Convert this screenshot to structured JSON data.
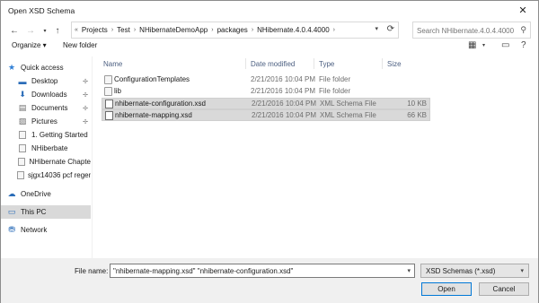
{
  "window": {
    "title": "Open XSD Schema",
    "close_glyph": "✕"
  },
  "nav": {
    "back_icon": "back-arrow-icon",
    "forward_icon": "forward-arrow-icon",
    "recent_icon": "chevron-down-icon",
    "up_icon": "up-arrow-icon",
    "prefix": "«",
    "breadcrumbs": [
      "Projects",
      "Test",
      "NHibernateDemoApp",
      "packages",
      "NHibernate.4.0.4.4000"
    ],
    "search_placeholder": "Search NHibernate.4.0.4.4000"
  },
  "toolbar": {
    "organize_label": "Organize ▾",
    "new_folder_label": "New folder"
  },
  "sidebar": {
    "quick_access": "Quick access",
    "items": [
      {
        "label": "Desktop",
        "icon": "desktop-icon"
      },
      {
        "label": "Downloads",
        "icon": "downloads-icon"
      },
      {
        "label": "Documents",
        "icon": "documents-icon"
      },
      {
        "label": "Pictures",
        "icon": "pictures-icon"
      },
      {
        "label": "1. Getting Started",
        "icon": "folder-icon"
      },
      {
        "label": "NHiberbate",
        "icon": "folder-icon"
      },
      {
        "label": "NHibernate Chapte",
        "icon": "folder-icon"
      },
      {
        "label": "sjgx14036 pcf regen",
        "icon": "folder-icon"
      }
    ],
    "onedrive": "OneDrive",
    "this_pc": "This PC",
    "network": "Network"
  },
  "columns": {
    "name": "Name",
    "date": "Date modified",
    "type": "Type",
    "size": "Size"
  },
  "files": [
    {
      "name": "ConfigurationTemplates",
      "date": "2/21/2016 10:04 PM",
      "type": "File folder",
      "size": "",
      "kind": "folder",
      "selected": false
    },
    {
      "name": "lib",
      "date": "2/21/2016 10:04 PM",
      "type": "File folder",
      "size": "",
      "kind": "folder",
      "selected": false
    },
    {
      "name": "nhibernate-configuration.xsd",
      "date": "2/21/2016 10:04 PM",
      "type": "XML Schema File",
      "size": "10 KB",
      "kind": "xsd",
      "selected": true
    },
    {
      "name": "nhibernate-mapping.xsd",
      "date": "2/21/2016 10:04 PM",
      "type": "XML Schema File",
      "size": "66 KB",
      "kind": "xsd",
      "selected": true
    }
  ],
  "footer": {
    "file_name_label": "File name:",
    "file_name_value": "\"nhibernate-mapping.xsd\" \"nhibernate-configuration.xsd\"",
    "filter_value": "XSD Schemas (*.xsd)",
    "open_label": "Open",
    "cancel_label": "Cancel"
  },
  "colors": {
    "header_text": "#4d6082",
    "selection": "#d9d9d9",
    "primary_border": "#0078d7"
  }
}
